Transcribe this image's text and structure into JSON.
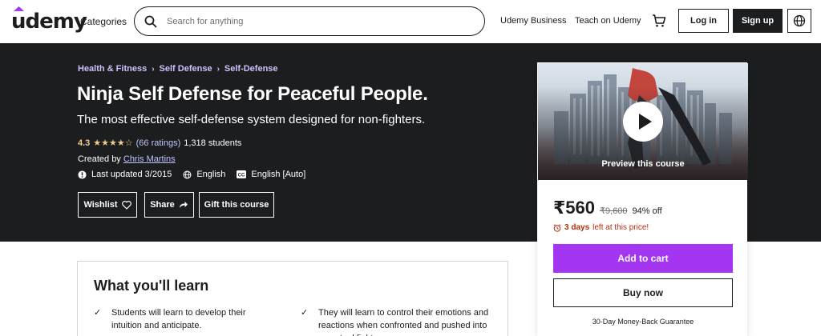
{
  "header": {
    "logo": "udemy",
    "categories": "Categories",
    "search_placeholder": "Search for anything",
    "business": "Udemy Business",
    "teach": "Teach on Udemy",
    "login": "Log in",
    "signup": "Sign up"
  },
  "course": {
    "breadcrumb": [
      "Health & Fitness",
      "Self Defense",
      "Self-Defense"
    ],
    "title": "Ninja Self Defense for Peaceful People.",
    "subtitle": "The most effective self-defense system designed for non-fighters.",
    "rating": "4.3",
    "stars": "★★★★☆",
    "ratings_count": "(66 ratings)",
    "students": "1,318 students",
    "created_prefix": "Created by",
    "instructor": "Chris Martins",
    "last_updated": "Last updated 3/2015",
    "language": "English",
    "captions": "English [Auto]",
    "actions": {
      "wishlist": "Wishlist",
      "share": "Share",
      "gift": "Gift this course"
    }
  },
  "sidebar": {
    "preview_label": "Preview this course",
    "price": "₹560",
    "original_price": "₹9,600",
    "discount": "94% off",
    "timer_bold": "3 days",
    "timer_rest": "left at this price!",
    "add_to_cart": "Add to cart",
    "buy_now": "Buy now",
    "guarantee": "30-Day Money-Back Guarantee"
  },
  "learn": {
    "title": "What you'll learn",
    "items": [
      "Students will learn to develop their intuition and anticipate.",
      "They will learn to control their emotions and reactions when confronted and pushed into an actual fight."
    ]
  },
  "colors": {
    "brand_purple": "#a435f0",
    "dark_bg": "#1c1d1f",
    "breadcrumb": "#cec0fc",
    "star": "#f3ca8c",
    "timer": "#b32d0f"
  }
}
